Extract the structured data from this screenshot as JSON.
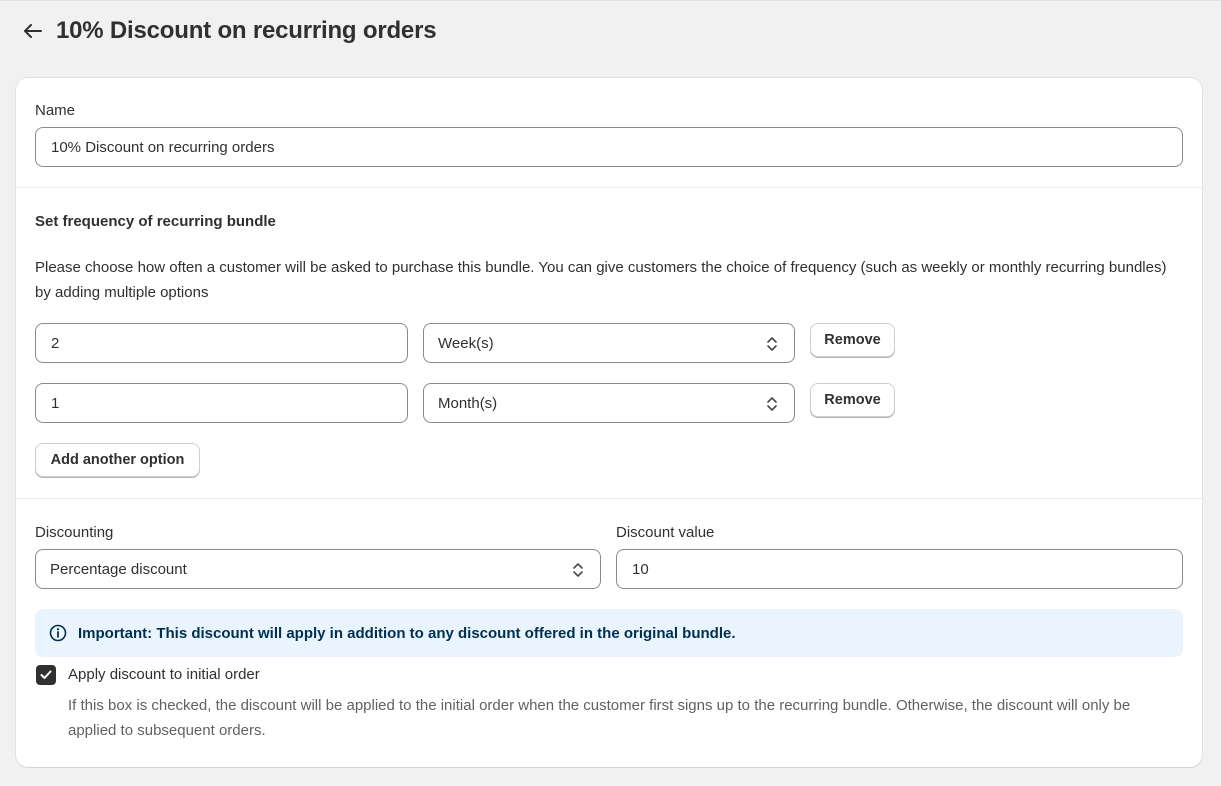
{
  "header": {
    "title": "10% Discount on recurring orders"
  },
  "name_field": {
    "label": "Name",
    "value": "10% Discount on recurring orders"
  },
  "frequency": {
    "heading": "Set frequency of recurring bundle",
    "description": "Please choose how often a customer will be asked to purchase this bundle. You can give customers the choice of frequency (such as weekly or monthly recurring bundles) by adding multiple options",
    "options": [
      {
        "interval": "2",
        "unit": "Week(s)",
        "remove_label": "Remove"
      },
      {
        "interval": "1",
        "unit": "Month(s)",
        "remove_label": "Remove"
      }
    ],
    "add_label": "Add another option"
  },
  "discount": {
    "type_label": "Discounting",
    "type_value": "Percentage discount",
    "value_label": "Discount value",
    "value": "10",
    "banner": "Important: This discount will apply in addition to any discount offered in the original bundle.",
    "apply_initial_label": "Apply discount to initial order",
    "apply_initial_checked": true,
    "apply_initial_help": "If this box is checked, the discount will be applied to the initial order when the customer first signs up to the recurring bundle. Otherwise, the discount will only be applied to subsequent orders."
  },
  "icons": {
    "back": "arrow-left-icon",
    "select": "chevron-up-down-icon",
    "info": "info-icon",
    "check": "checkmark-icon"
  },
  "colors": {
    "banner_bg": "#eaf4ff",
    "banner_text": "#00304f",
    "checkbox": "#303030"
  }
}
